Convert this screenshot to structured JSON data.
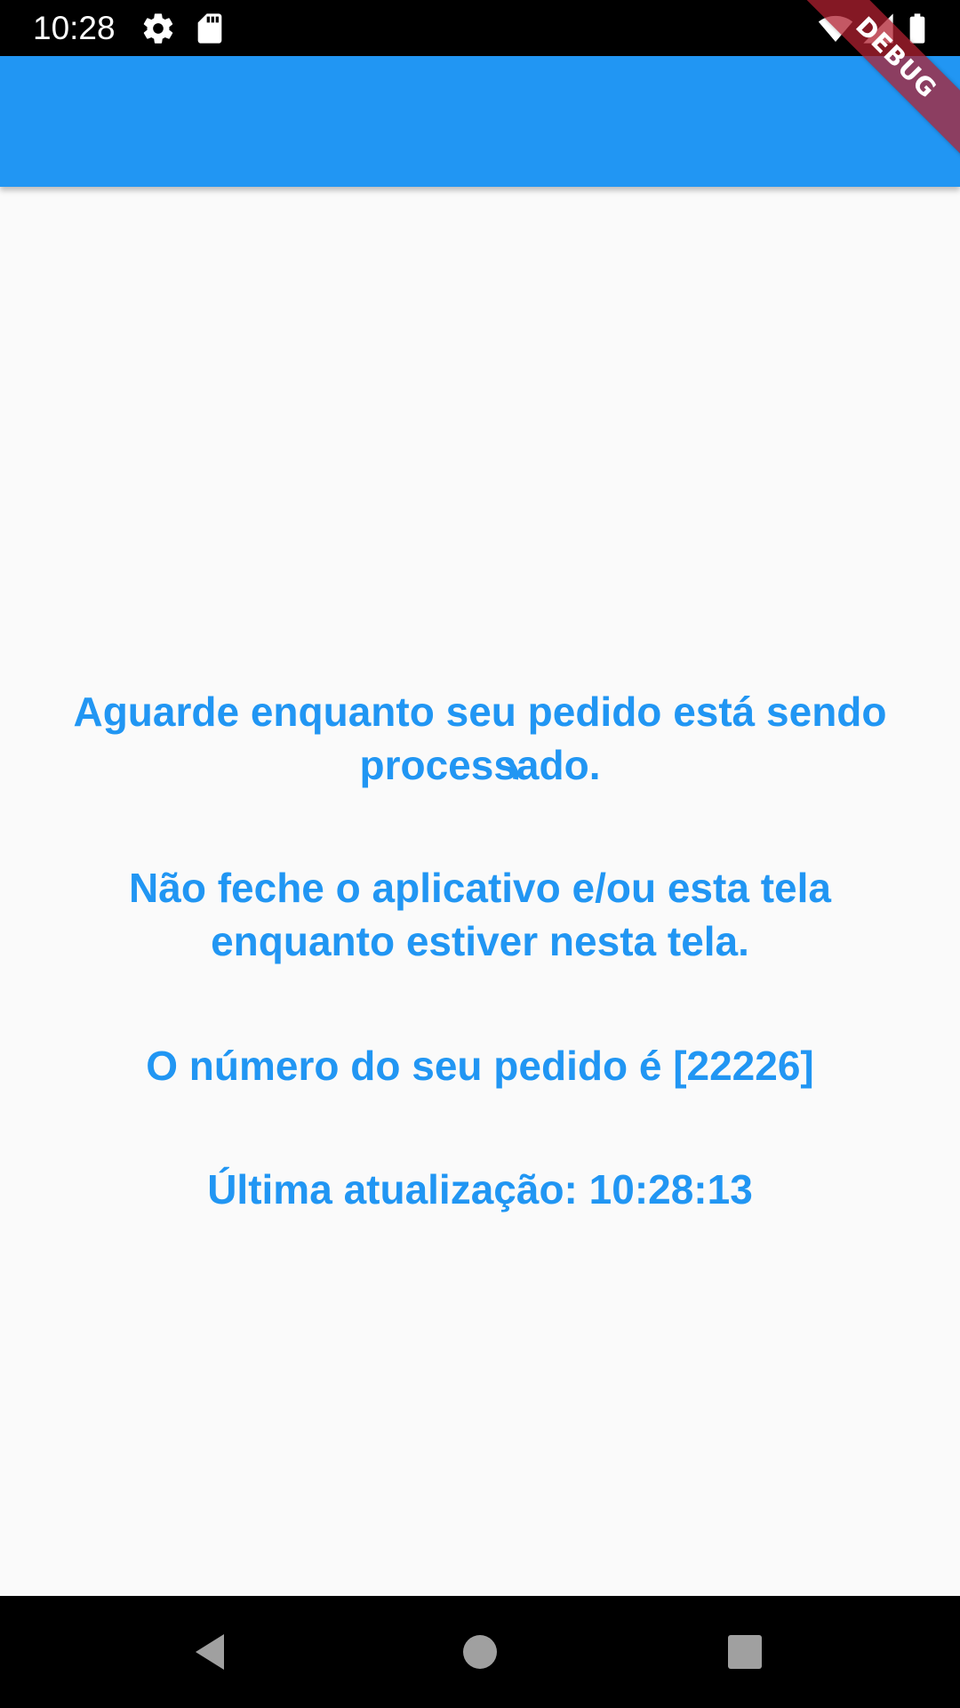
{
  "status_bar": {
    "time": "10:28",
    "icons": [
      "gear-icon",
      "sd-card-icon",
      "wifi-icon",
      "signal-icon",
      "battery-icon"
    ]
  },
  "app_bar": {
    "title": "",
    "color": "#2196f3"
  },
  "debug_banner": {
    "label": "DEBUG"
  },
  "content": {
    "message_processing": "Aguarde enquanto seu pedido está sendo processado.",
    "message_warning": "Não feche o aplicativo e/ou esta tela enquanto estiver nesta tela.",
    "order_number_text": "O número do seu pedido é [22226]",
    "last_update_text": "Última atualização: 10:28:13",
    "text_color": "#2196f3"
  },
  "nav_bar": {
    "buttons": [
      "back-icon",
      "home-icon",
      "recents-icon"
    ]
  }
}
